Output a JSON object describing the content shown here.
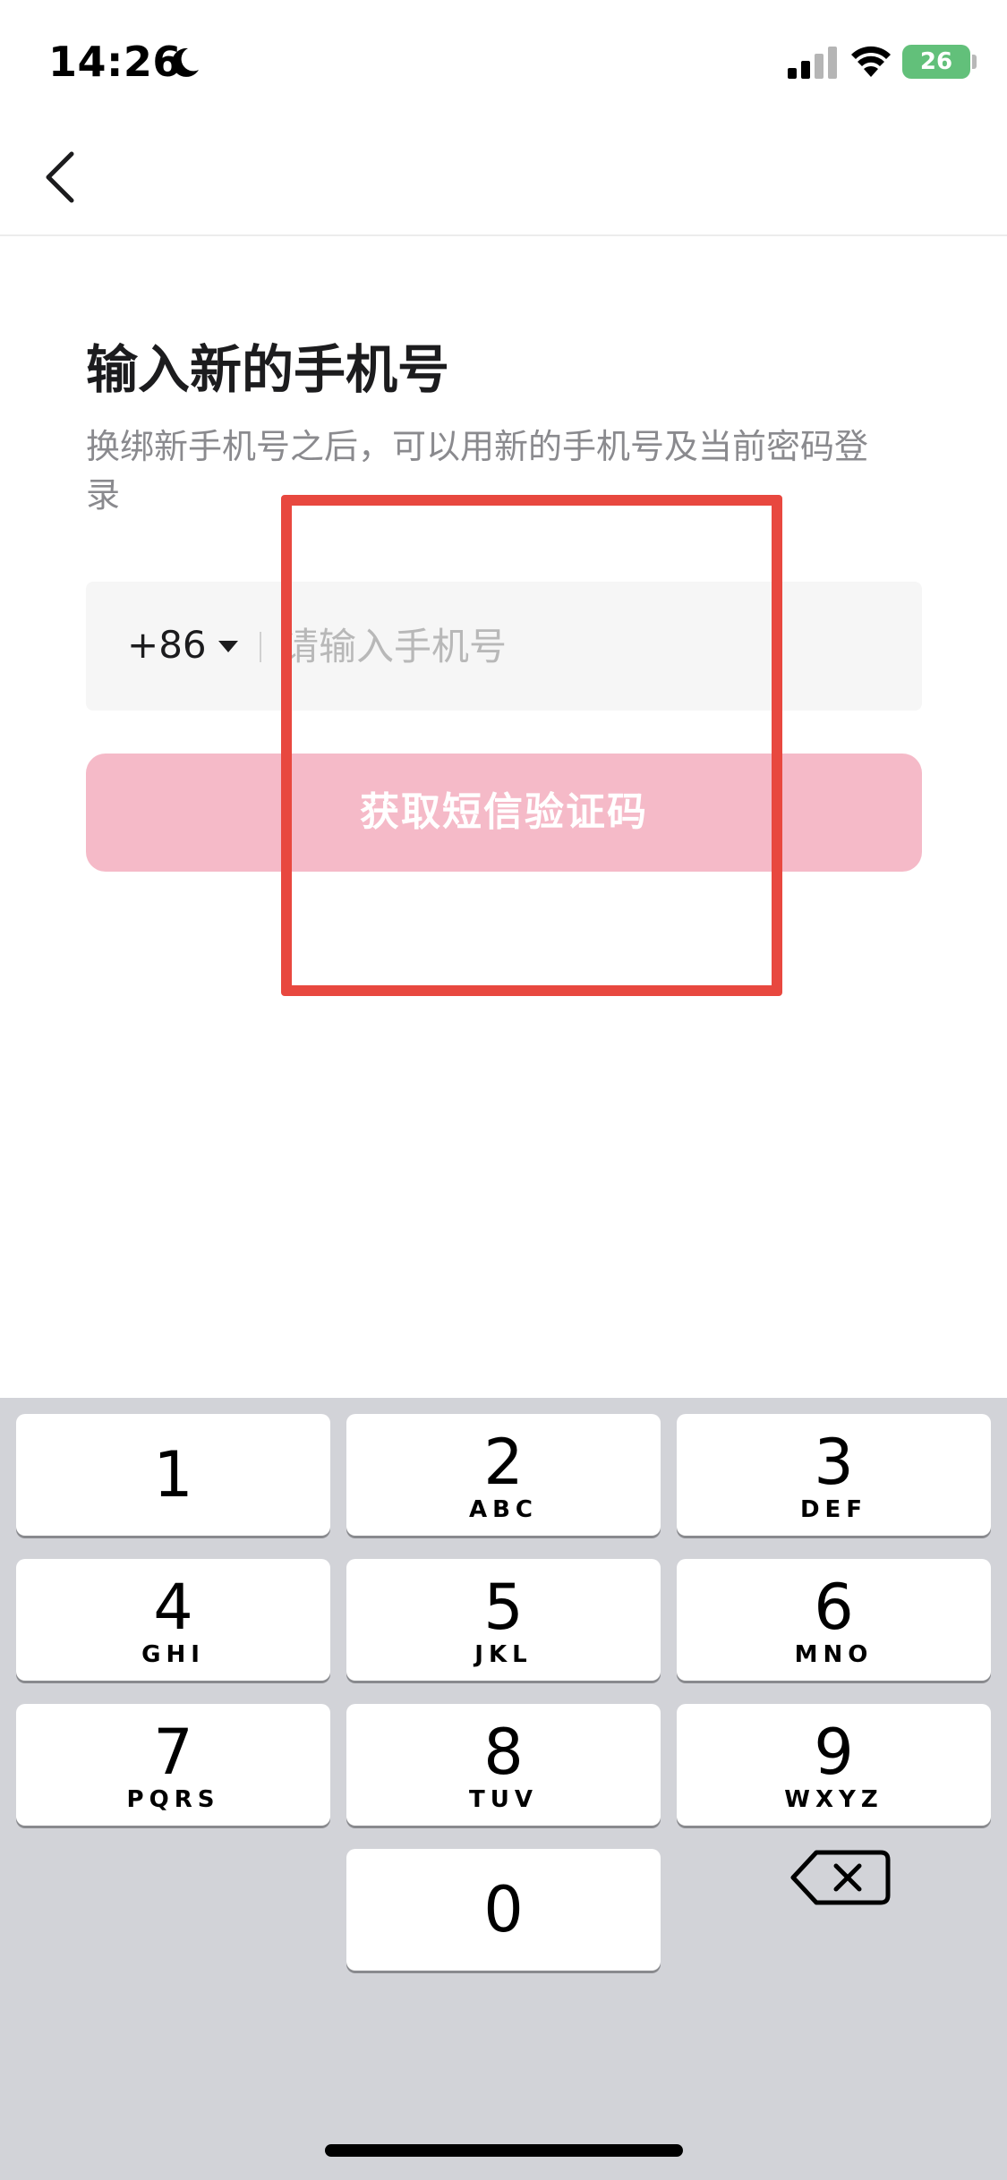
{
  "status_bar": {
    "time": "14:26",
    "battery": "26"
  },
  "header": {
    "back_icon": "chevron-left-icon"
  },
  "main": {
    "title": "输入新的手机号",
    "subtitle": "换绑新手机号之后，可以用新的手机号及当前密码登录",
    "country_code": "+86",
    "phone_placeholder": "请输入手机号",
    "phone_value": "",
    "sms_button_label": "获取短信验证码"
  },
  "keyboard": {
    "keys": [
      {
        "digit": "1",
        "letters": ""
      },
      {
        "digit": "2",
        "letters": "ABC"
      },
      {
        "digit": "3",
        "letters": "DEF"
      },
      {
        "digit": "4",
        "letters": "GHI"
      },
      {
        "digit": "5",
        "letters": "JKL"
      },
      {
        "digit": "6",
        "letters": "MNO"
      },
      {
        "digit": "7",
        "letters": "PQRS"
      },
      {
        "digit": "8",
        "letters": "TUV"
      },
      {
        "digit": "9",
        "letters": "WXYZ"
      },
      {
        "digit": "0",
        "letters": ""
      }
    ],
    "delete_icon": "backspace-icon"
  },
  "colors": {
    "accent_disabled": "#f5bac8",
    "highlight": "#e8483f",
    "keyboard_bg": "#d2d3d8"
  }
}
